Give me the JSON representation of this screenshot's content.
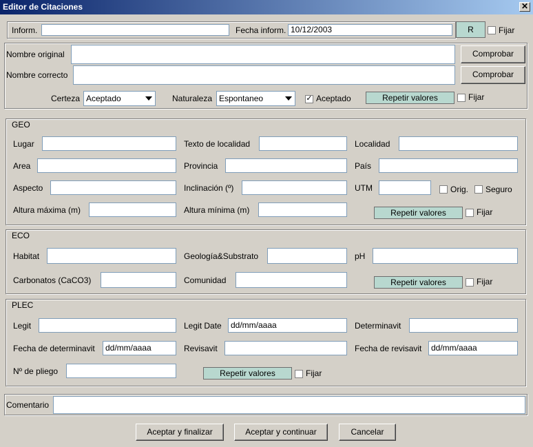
{
  "window": {
    "title": "Editor de Citaciones",
    "close_glyph": "✕"
  },
  "top": {
    "inform_label": "Inform.",
    "inform_value": "",
    "fecha_label": "Fecha inform.",
    "fecha_value": "10/12/2003",
    "r_button": "R",
    "fijar_label": "Fijar",
    "fijar_checked": false
  },
  "names": {
    "original_label": "Nombre original",
    "original_value": "",
    "correcto_label": "Nombre correcto",
    "correcto_value": "",
    "comprobar_label": "Comprobar",
    "certeza_label": "Certeza",
    "certeza_value": "Aceptado",
    "naturaleza_label": "Naturaleza",
    "naturaleza_value": "Espontaneo",
    "aceptado_label": "Aceptado",
    "aceptado_checked": true,
    "repetir_label": "Repetir valores",
    "fijar_label": "Fijar",
    "fijar_checked": false
  },
  "geo": {
    "title": "GEO",
    "lugar": "Lugar",
    "texto_localidad": "Texto de localidad",
    "localidad": "Localidad",
    "area": "Area",
    "provincia": "Provincia",
    "pais": "País",
    "aspecto": "Aspecto",
    "inclinacion": "Inclinación (º)",
    "utm": "UTM",
    "orig": "Orig.",
    "seguro": "Seguro",
    "altura_max": "Altura máxima (m)",
    "altura_min": "Altura mínima (m)",
    "repetir_label": "Repetir valores",
    "fijar_label": "Fijar"
  },
  "eco": {
    "title": "ECO",
    "habitat": "Habitat",
    "geologia": "Geología&Substrato",
    "ph": "pH",
    "carbonatos": "Carbonatos (CaCO3)",
    "comunidad": "Comunidad",
    "repetir_label": "Repetir valores",
    "fijar_label": "Fijar"
  },
  "plec": {
    "title": "PLEC",
    "legit": "Legit",
    "legit_date": "Legit Date",
    "legit_date_value": "dd/mm/aaaa",
    "determinavit": "Determinavit",
    "fecha_determinavit": "Fecha de determinavit",
    "fecha_determinavit_value": "dd/mm/aaaa",
    "revisavit": "Revisavit",
    "fecha_revisavit": "Fecha de revisavit",
    "fecha_revisavit_value": "dd/mm/aaaa",
    "n_pliego": "Nº de pliego",
    "repetir_label": "Repetir valores",
    "fijar_label": "Fijar"
  },
  "comentario": {
    "label": "Comentario",
    "value": ""
  },
  "footer": {
    "aceptar_finalizar": "Aceptar y finalizar",
    "aceptar_continuar": "Aceptar y continuar",
    "cancelar": "Cancelar"
  },
  "colors": {
    "titlebar_start": "#0a246a",
    "titlebar_end": "#a6caf0",
    "dialog_bg": "#d4d0c8",
    "accent_button": "#b8d8cf"
  }
}
